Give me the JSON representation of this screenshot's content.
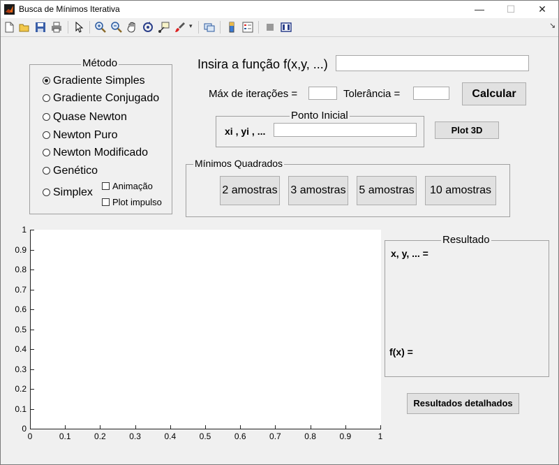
{
  "window": {
    "title": "Busca de Mínimos Iterativa",
    "minimize": "—",
    "maximize": "☐",
    "close": "✕"
  },
  "metodo": {
    "title": "Método",
    "options": [
      "Gradiente Simples",
      "Gradiente Conjugado",
      "Quase Newton",
      "Newton Puro",
      "Newton Modificado",
      "Genético",
      "Simplex"
    ],
    "selected": "Gradiente Simples",
    "animacao": "Animação",
    "plot_impulso": "Plot impulso"
  },
  "funcao": {
    "label": "Insira a função f(x,y, ...)",
    "value": ""
  },
  "iteracoes": {
    "label": "Máx de iterações =",
    "value": ""
  },
  "tolerancia": {
    "label": "Tolerância =",
    "value": ""
  },
  "calcular": "Calcular",
  "ponto_inicial": {
    "title": "Ponto Inicial",
    "label": "xi , yi , ...",
    "value": ""
  },
  "plot3d": "Plot 3D",
  "minimos": {
    "title": "Mínimos Quadrados",
    "buttons": [
      "2 amostras",
      "3 amostras",
      "5 amostras",
      "10 amostras"
    ]
  },
  "resultado": {
    "title": "Resultado",
    "xy_label": "x, y, ... =",
    "fx_label": "f(x) ="
  },
  "detalhados": "Resultados detalhados",
  "chart_data": {
    "type": "line",
    "series": [],
    "xlim": [
      0,
      1
    ],
    "ylim": [
      0,
      1
    ],
    "xticks": [
      "0",
      "0.1",
      "0.2",
      "0.3",
      "0.4",
      "0.5",
      "0.6",
      "0.7",
      "0.8",
      "0.9",
      "1"
    ],
    "yticks": [
      "0",
      "0.1",
      "0.2",
      "0.3",
      "0.4",
      "0.5",
      "0.6",
      "0.7",
      "0.8",
      "0.9",
      "1"
    ]
  }
}
